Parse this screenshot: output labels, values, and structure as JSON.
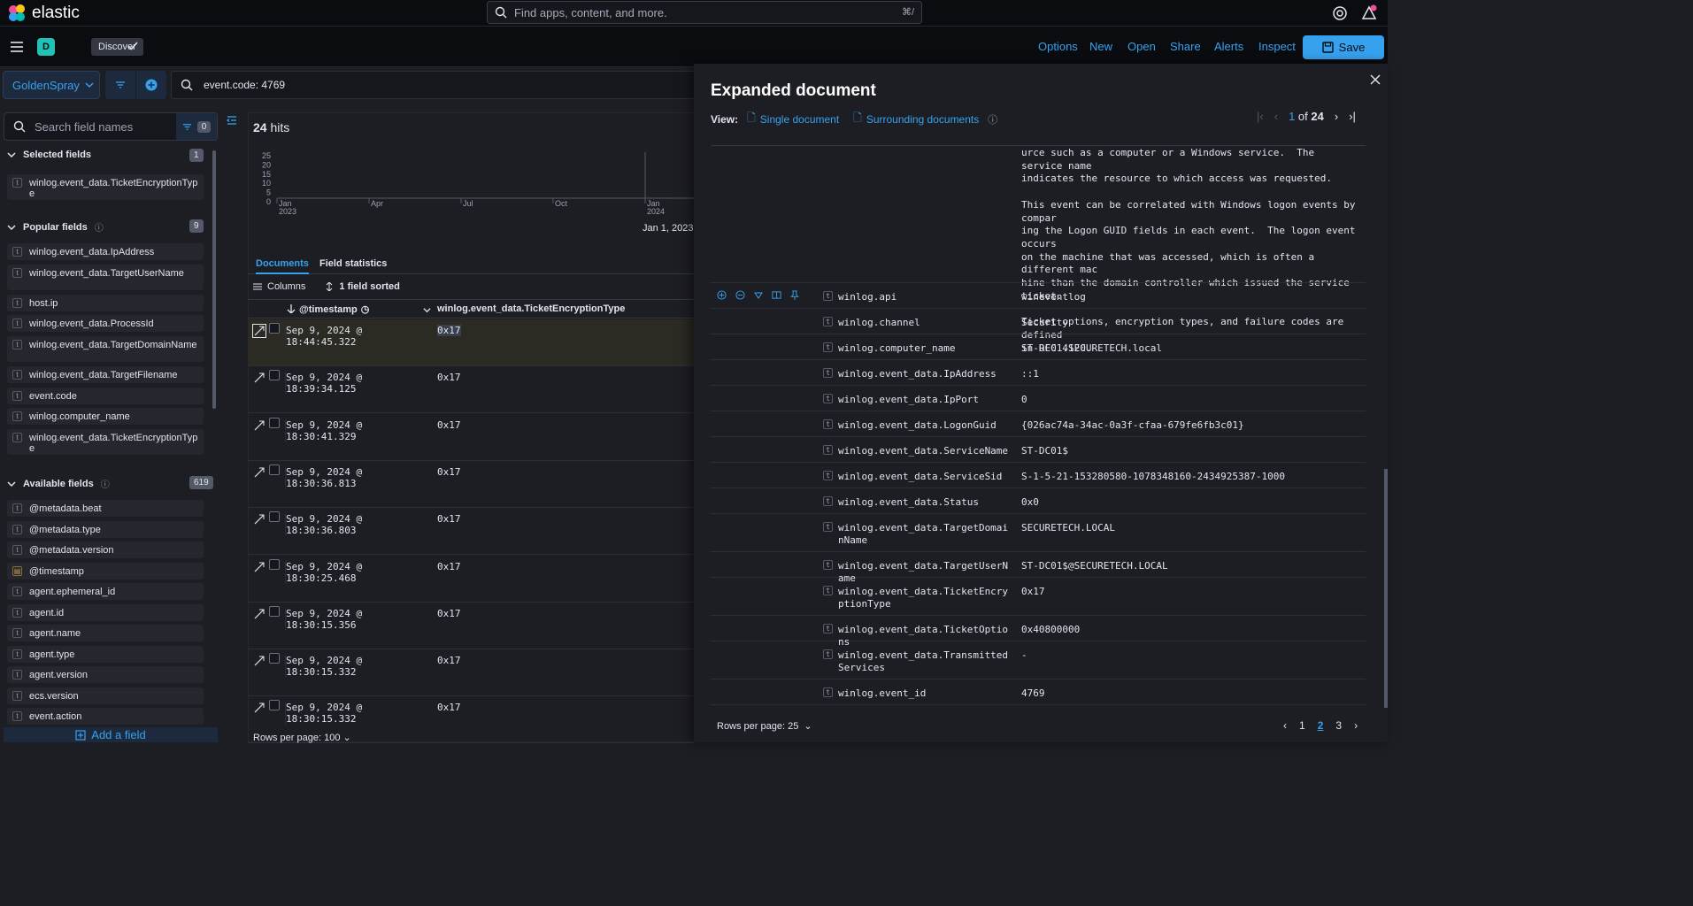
{
  "header": {
    "logo_text": "elastic",
    "search_placeholder": "Find apps, content, and more.",
    "search_shortcut": "⌘/"
  },
  "appbar": {
    "space_initial": "D",
    "breadcrumb": "Discover",
    "links": [
      "Options",
      "New",
      "Open",
      "Share",
      "Alerts",
      "Inspect"
    ],
    "save_label": "Save"
  },
  "query": {
    "data_view": "GoldenSpray",
    "text": "event.code: 4769"
  },
  "sidebar": {
    "search_placeholder": "Search field names",
    "filter_count": "0",
    "selected": {
      "title": "Selected fields",
      "count": "1",
      "items": [
        "winlog.event_data.TicketEncryptionType"
      ]
    },
    "popular": {
      "title": "Popular fields",
      "count": "9",
      "items": [
        "winlog.event_data.IpAddress",
        "winlog.event_data.TargetUserName",
        "host.ip",
        "winlog.event_data.ProcessId",
        "winlog.event_data.TargetDomainName",
        "winlog.event_data.TargetFilename",
        "event.code",
        "winlog.computer_name",
        "winlog.event_data.TicketEncryptionType"
      ]
    },
    "available": {
      "title": "Available fields",
      "count": "619",
      "items": [
        "@metadata.beat",
        "@metadata.type",
        "@metadata.version",
        "@timestamp",
        "agent.ephemeral_id",
        "agent.id",
        "agent.name",
        "agent.type",
        "agent.version",
        "ecs.version",
        "event.action"
      ]
    },
    "add_field": "Add a field"
  },
  "main": {
    "hits_count": "24",
    "hits_label": "hits",
    "chart_date": "Jan 1, 2023 @",
    "tabs": [
      "Documents",
      "Field statistics"
    ],
    "columns_label": "Columns",
    "sorted_label": "1 field sorted",
    "col_timestamp": "@timestamp",
    "col_field": "winlog.event_data.TicketEncryptionType",
    "rows": [
      {
        "ts": "Sep 9, 2024 @ 18:44:45.322",
        "val": "0x17"
      },
      {
        "ts": "Sep 9, 2024 @ 18:39:34.125",
        "val": "0x17"
      },
      {
        "ts": "Sep 9, 2024 @ 18:30:41.329",
        "val": "0x17"
      },
      {
        "ts": "Sep 9, 2024 @ 18:30:36.813",
        "val": "0x17"
      },
      {
        "ts": "Sep 9, 2024 @ 18:30:36.803",
        "val": "0x17"
      },
      {
        "ts": "Sep 9, 2024 @ 18:30:25.468",
        "val": "0x17"
      },
      {
        "ts": "Sep 9, 2024 @ 18:30:15.356",
        "val": "0x17"
      },
      {
        "ts": "Sep 9, 2024 @ 18:30:15.332",
        "val": "0x17"
      },
      {
        "ts": "Sep 9, 2024 @ 18:30:15.332",
        "val": "0x17"
      }
    ],
    "rows_per_page": "Rows per page: 100"
  },
  "chart_data": {
    "type": "bar",
    "y_ticks": [
      "25",
      "20",
      "15",
      "10",
      "5",
      "0"
    ],
    "x_ticks": [
      "Jan\n2023",
      "Apr",
      "Jul",
      "Oct",
      "Jan\n2024",
      "Apr"
    ],
    "ylim": [
      0,
      25
    ]
  },
  "flyout": {
    "title": "Expanded document",
    "view_label": "View:",
    "single": "Single document",
    "surrounding": "Surrounding documents",
    "current": "1",
    "of": "of",
    "total": "24",
    "message": "urce such as a computer or a Windows service.  The service name\nindicates the resource to which access was requested.\n\nThis event can be correlated with Windows logon events by compar\ning the Logon GUID fields in each event.  The logon event occurs\non the machine that was accessed, which is often a different mac\nhine than the domain controller which issued the service ticket.\n\nTicket options, encryption types, and failure codes are defined\nin RFC 4120.",
    "fields": [
      {
        "k": "winlog.api",
        "v": "wineventlog"
      },
      {
        "k": "winlog.channel",
        "v": "Security"
      },
      {
        "k": "winlog.computer_name",
        "v": "ST-DC01.SECURETECH.local"
      },
      {
        "k": "winlog.event_data.IpAddress",
        "v": "::1"
      },
      {
        "k": "winlog.event_data.IpPort",
        "v": "0"
      },
      {
        "k": "winlog.event_data.LogonGuid",
        "v": "{026ac74a-34ac-0a3f-cfaa-679fe6fb3c01}"
      },
      {
        "k": "winlog.event_data.ServiceName",
        "v": "ST-DC01$"
      },
      {
        "k": "winlog.event_data.ServiceSid",
        "v": "S-1-5-21-153280580-1078348160-2434925387-1000"
      },
      {
        "k": "winlog.event_data.Status",
        "v": "0x0"
      },
      {
        "k": "winlog.event_data.TargetDomainName",
        "v": "SECURETECH.LOCAL"
      },
      {
        "k": "winlog.event_data.TargetUserName",
        "v": "ST-DC01$@SECURETECH.LOCAL"
      },
      {
        "k": "winlog.event_data.TicketEncryptionType",
        "v": "0x17"
      },
      {
        "k": "winlog.event_data.TicketOptions",
        "v": "0x40800000"
      },
      {
        "k": "winlog.event_data.TransmittedServices",
        "v": "-"
      },
      {
        "k": "winlog.event_id",
        "v": "4769"
      }
    ],
    "rows_per_page": "Rows per page: 25",
    "pages": [
      "1",
      "2",
      "3"
    ],
    "active_page": "2"
  }
}
